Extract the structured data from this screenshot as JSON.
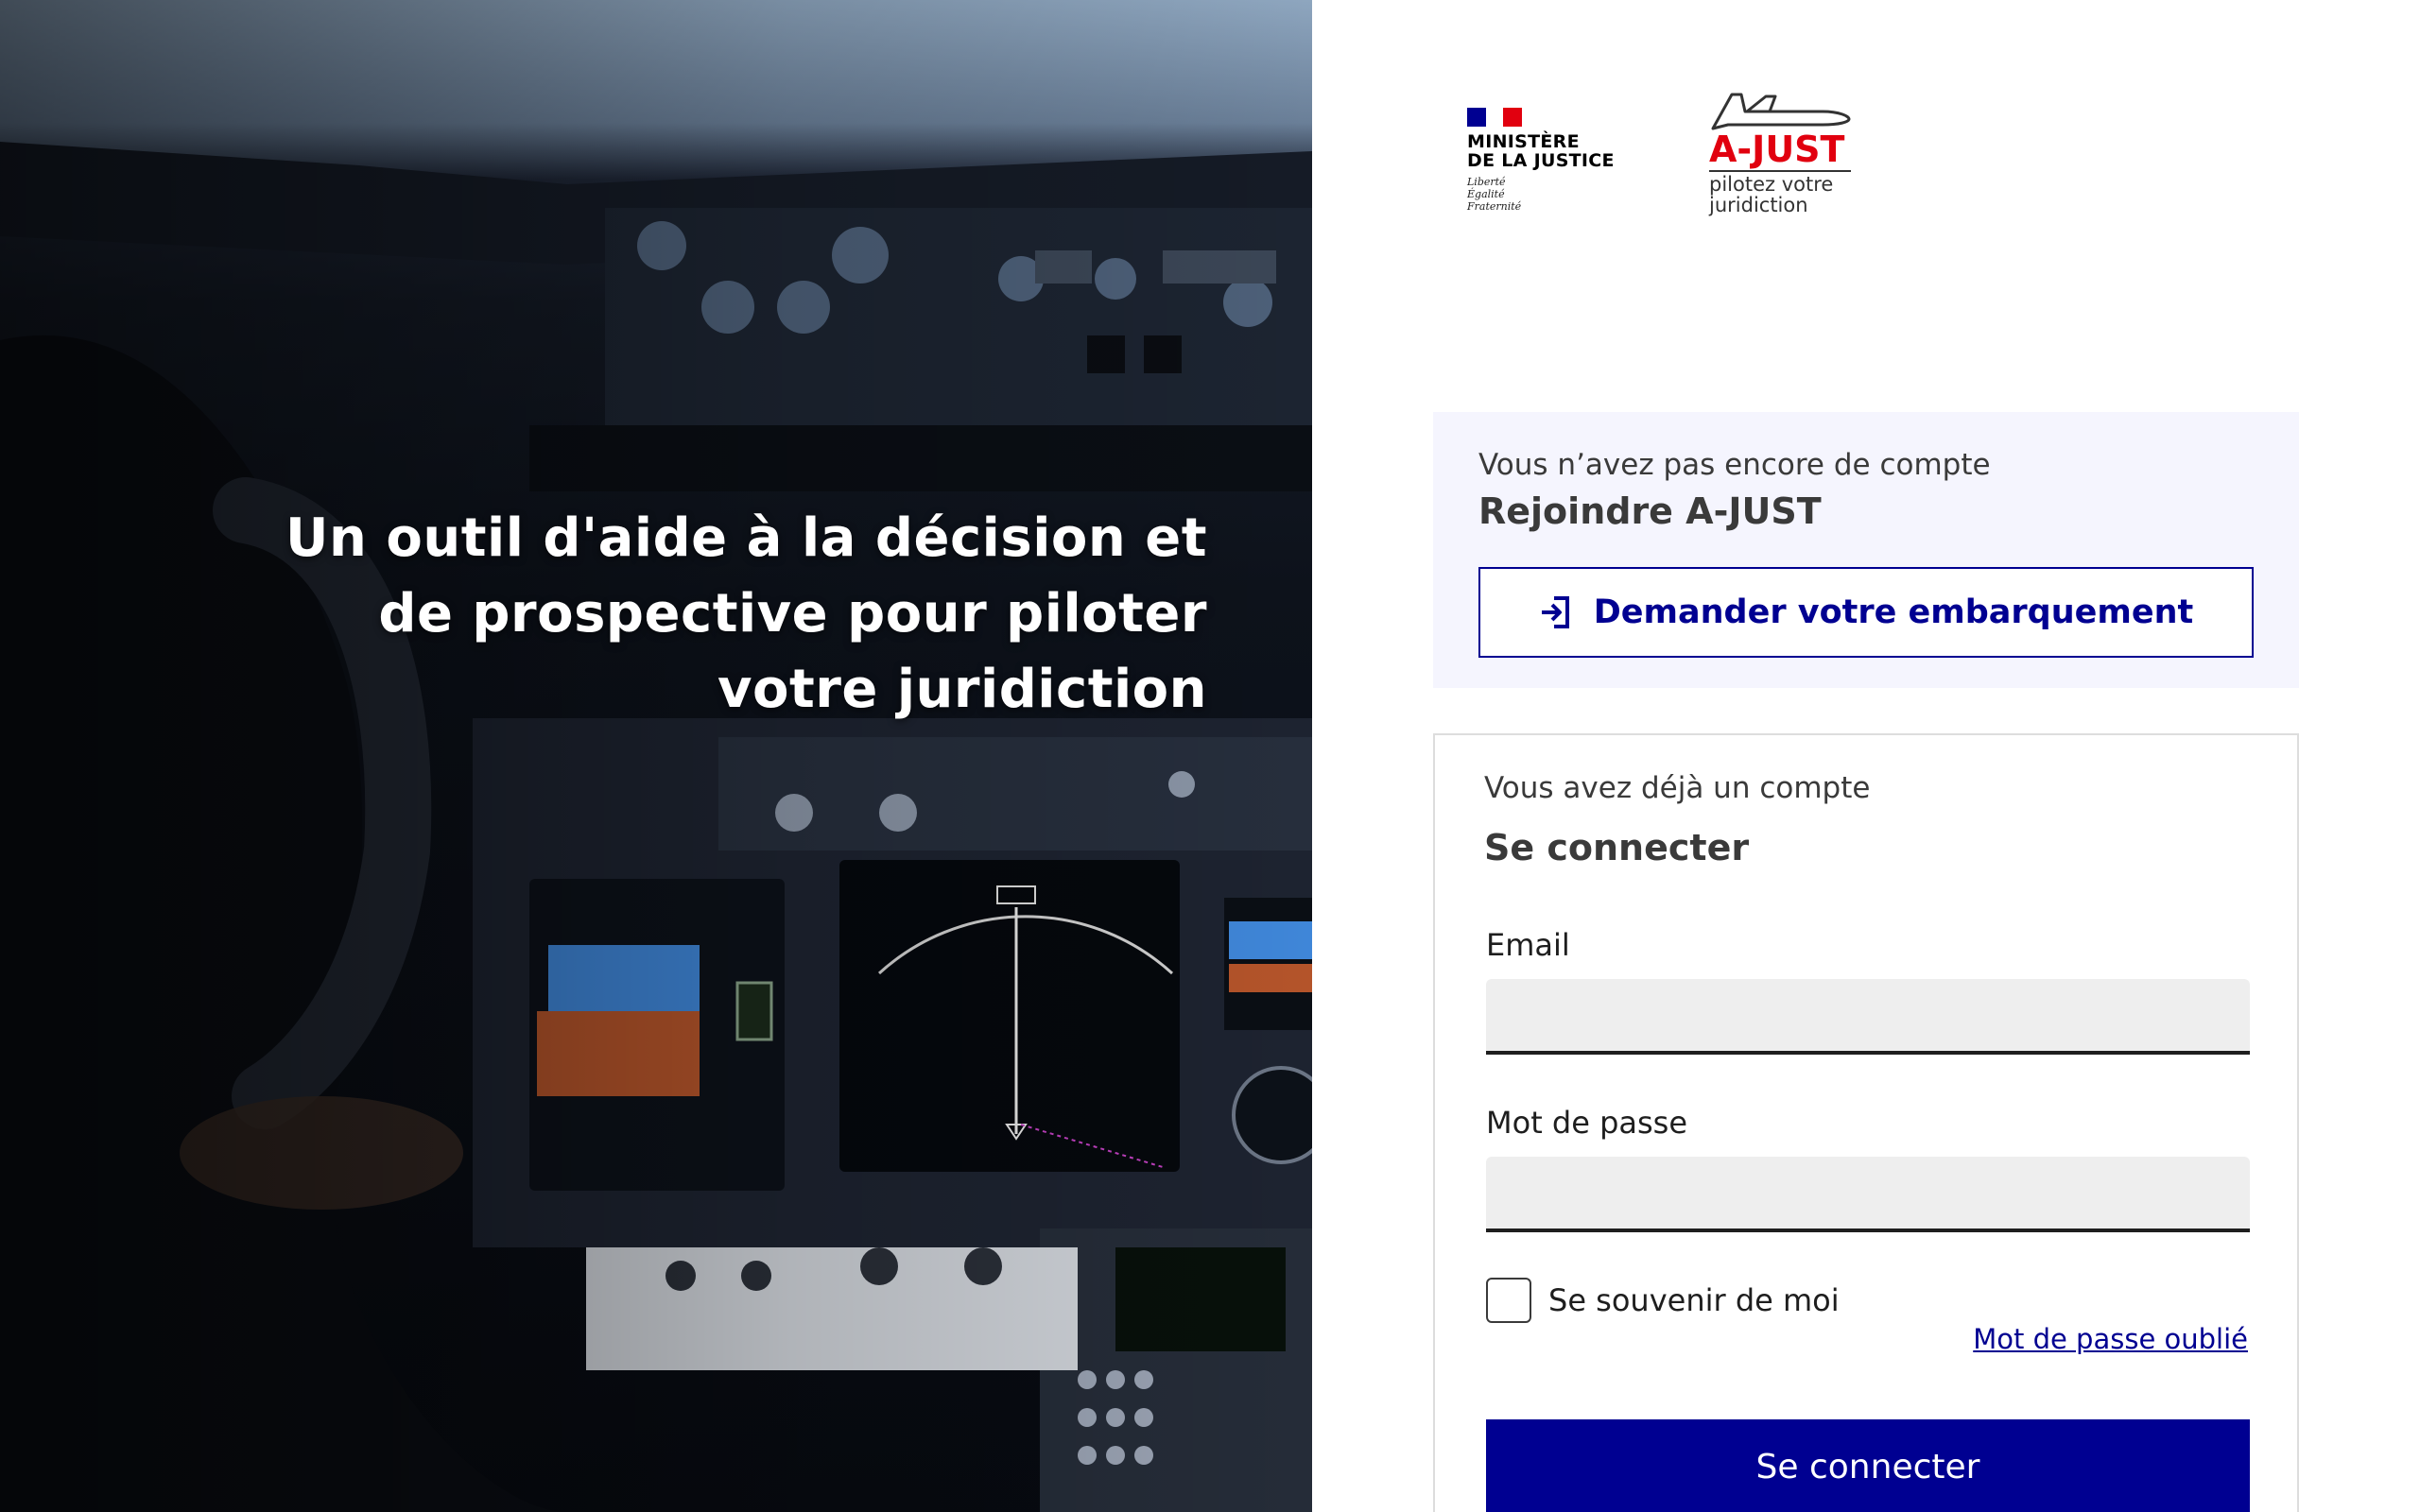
{
  "hero": {
    "lines": [
      "Un outil d'aide à la décision et",
      "de prospective pour piloter",
      "votre juridiction"
    ]
  },
  "logos": {
    "ministry_title_1": "MINISTÈRE",
    "ministry_title_2": "DE LA JUSTICE",
    "motto_1": "Liberté",
    "motto_2": "Égalité",
    "motto_3": "Fraternité",
    "app_name": "A-JUST",
    "app_tagline_1": "pilotez votre",
    "app_tagline_2": "juridiction"
  },
  "join": {
    "subtitle": "Vous n’avez pas encore de compte",
    "title": "Rejoindre A-JUST",
    "button_label": "Demander votre embarquement"
  },
  "login": {
    "subtitle": "Vous avez déjà un compte",
    "title": "Se connecter",
    "email_label": "Email",
    "email_value": "",
    "password_label": "Mot de passe",
    "password_value": "",
    "remember_label": "Se souvenir de moi",
    "forgot_label": "Mot de passe oublié",
    "submit_label": "Se connecter"
  },
  "colors": {
    "primary": "#000091",
    "brand_red": "#e1000f",
    "join_bg": "#f5f5fe"
  }
}
